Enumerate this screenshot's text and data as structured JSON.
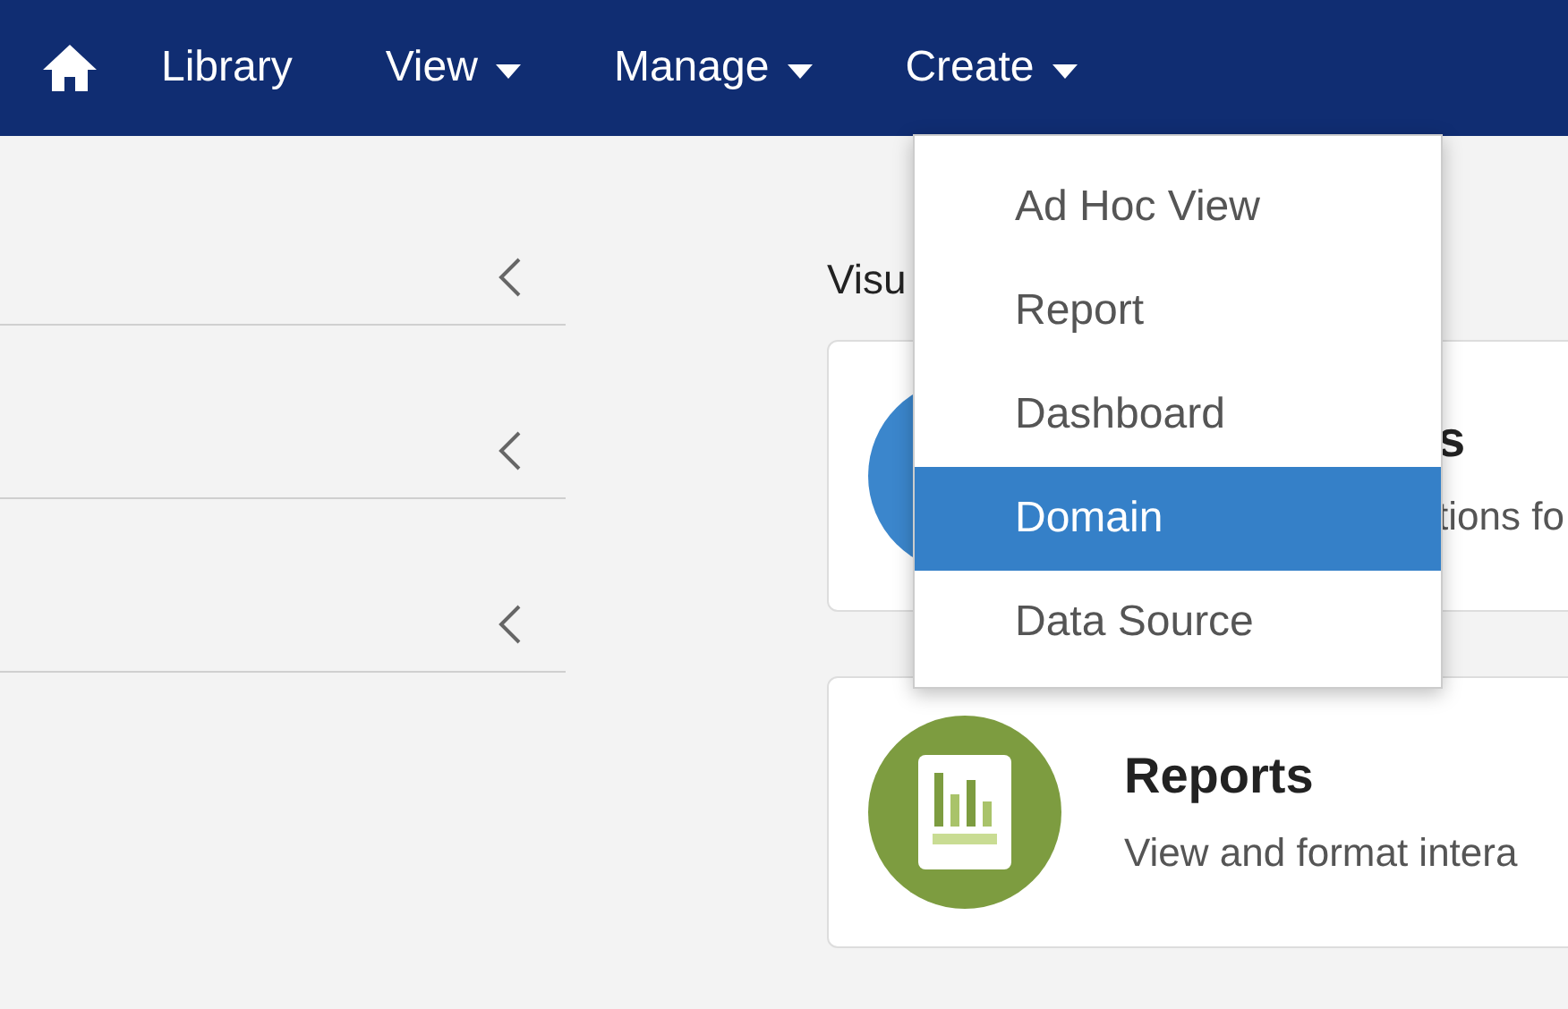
{
  "nav": {
    "items": [
      {
        "label": "Library",
        "caret": false
      },
      {
        "label": "View",
        "caret": true
      },
      {
        "label": "Manage",
        "caret": true
      },
      {
        "label": "Create",
        "caret": true
      }
    ]
  },
  "sidebar": {
    "sections": [
      {
        "collapsed": true
      },
      {
        "collapsed": true
      },
      {
        "collapsed": true
      }
    ]
  },
  "main": {
    "heading": "Visu",
    "cards": [
      {
        "kind": "circle",
        "title": "s",
        "description": "tions fo"
      },
      {
        "kind": "report",
        "title": "Reports",
        "description": "View and format intera"
      }
    ]
  },
  "create_menu": {
    "items": [
      {
        "label": "Ad Hoc View",
        "selected": false
      },
      {
        "label": "Report",
        "selected": false
      },
      {
        "label": "Dashboard",
        "selected": false
      },
      {
        "label": "Domain",
        "selected": true
      },
      {
        "label": "Data Source",
        "selected": false
      }
    ]
  }
}
